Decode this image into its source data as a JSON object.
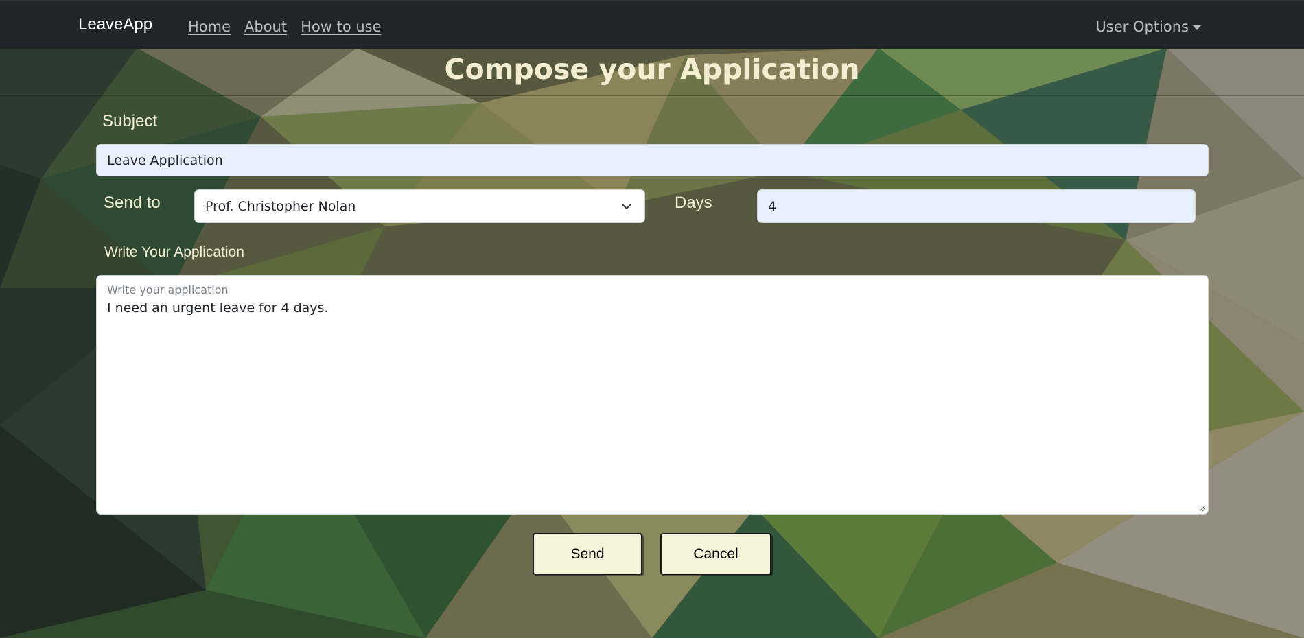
{
  "navbar": {
    "brand": "LeaveApp",
    "links": [
      "Home",
      "About",
      "How to use"
    ],
    "user_options": "User Options"
  },
  "page": {
    "title": "Compose your Application"
  },
  "form": {
    "subject_label": "Subject",
    "subject_value": "Leave Application",
    "send_to_label": "Send to",
    "send_to_value": "Prof. Christopher Nolan",
    "days_label": "Days",
    "days_value": "4",
    "write_label": "Write Your Application",
    "application_placeholder": "Write your application",
    "application_value": "I need an urgent leave for 4 days.",
    "send_label": "Send",
    "cancel_label": "Cancel"
  },
  "colors": {
    "navbar_bg": "#212529",
    "label_text": "#f3eed2",
    "input_autofill_bg": "#e8f0fe",
    "button_bg": "#f5f3da"
  },
  "icons": {
    "select_arrow": "chevron-down-icon",
    "dropdown_caret": "caret-down-icon",
    "resize": "resize-handle-icon"
  }
}
